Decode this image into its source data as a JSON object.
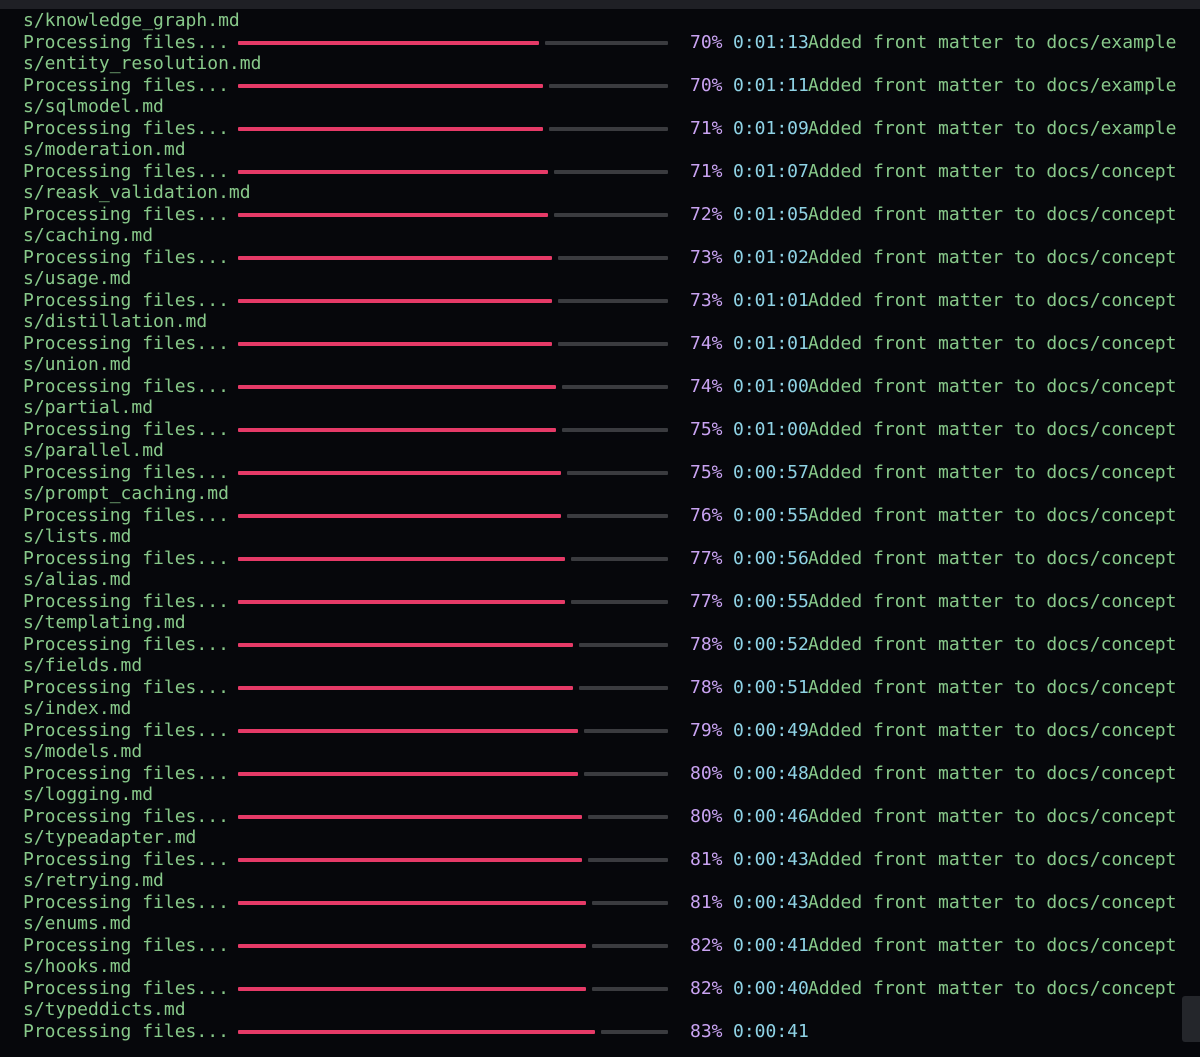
{
  "terminal": {
    "label": "Processing files...",
    "rows": [
      {
        "file": "s/knowledge_graph.md",
        "percent": "70%",
        "progress": 0.7,
        "eta": "0:01:13",
        "message": "Added front matter to docs/example"
      },
      {
        "file": "s/entity_resolution.md",
        "percent": "70%",
        "progress": 0.71,
        "eta": "0:01:11",
        "message": "Added front matter to docs/example"
      },
      {
        "file": "s/sqlmodel.md",
        "percent": "71%",
        "progress": 0.71,
        "eta": "0:01:09",
        "message": "Added front matter to docs/example"
      },
      {
        "file": "s/moderation.md",
        "percent": "71%",
        "progress": 0.72,
        "eta": "0:01:07",
        "message": "Added front matter to docs/concept"
      },
      {
        "file": "s/reask_validation.md",
        "percent": "72%",
        "progress": 0.72,
        "eta": "0:01:05",
        "message": "Added front matter to docs/concept"
      },
      {
        "file": "s/caching.md",
        "percent": "73%",
        "progress": 0.73,
        "eta": "0:01:02",
        "message": "Added front matter to docs/concept"
      },
      {
        "file": "s/usage.md",
        "percent": "73%",
        "progress": 0.73,
        "eta": "0:01:01",
        "message": "Added front matter to docs/concept"
      },
      {
        "file": "s/distillation.md",
        "percent": "74%",
        "progress": 0.73,
        "eta": "0:01:01",
        "message": "Added front matter to docs/concept"
      },
      {
        "file": "s/union.md",
        "percent": "74%",
        "progress": 0.74,
        "eta": "0:01:00",
        "message": "Added front matter to docs/concept"
      },
      {
        "file": "s/partial.md",
        "percent": "75%",
        "progress": 0.74,
        "eta": "0:01:00",
        "message": "Added front matter to docs/concept"
      },
      {
        "file": "s/parallel.md",
        "percent": "75%",
        "progress": 0.75,
        "eta": "0:00:57",
        "message": "Added front matter to docs/concept"
      },
      {
        "file": "s/prompt_caching.md",
        "percent": "76%",
        "progress": 0.75,
        "eta": "0:00:55",
        "message": "Added front matter to docs/concept"
      },
      {
        "file": "s/lists.md",
        "percent": "77%",
        "progress": 0.76,
        "eta": "0:00:56",
        "message": "Added front matter to docs/concept"
      },
      {
        "file": "s/alias.md",
        "percent": "77%",
        "progress": 0.76,
        "eta": "0:00:55",
        "message": "Added front matter to docs/concept"
      },
      {
        "file": "s/templating.md",
        "percent": "78%",
        "progress": 0.78,
        "eta": "0:00:52",
        "message": "Added front matter to docs/concept"
      },
      {
        "file": "s/fields.md",
        "percent": "78%",
        "progress": 0.78,
        "eta": "0:00:51",
        "message": "Added front matter to docs/concept"
      },
      {
        "file": "s/index.md",
        "percent": "79%",
        "progress": 0.79,
        "eta": "0:00:49",
        "message": "Added front matter to docs/concept"
      },
      {
        "file": "s/models.md",
        "percent": "80%",
        "progress": 0.79,
        "eta": "0:00:48",
        "message": "Added front matter to docs/concept"
      },
      {
        "file": "s/logging.md",
        "percent": "80%",
        "progress": 0.8,
        "eta": "0:00:46",
        "message": "Added front matter to docs/concept"
      },
      {
        "file": "s/typeadapter.md",
        "percent": "81%",
        "progress": 0.8,
        "eta": "0:00:43",
        "message": "Added front matter to docs/concept"
      },
      {
        "file": "s/retrying.md",
        "percent": "81%",
        "progress": 0.81,
        "eta": "0:00:43",
        "message": "Added front matter to docs/concept"
      },
      {
        "file": "s/enums.md",
        "percent": "82%",
        "progress": 0.81,
        "eta": "0:00:41",
        "message": "Added front matter to docs/concept"
      },
      {
        "file": "s/hooks.md",
        "percent": "82%",
        "progress": 0.81,
        "eta": "0:00:40",
        "message": "Added front matter to docs/concept"
      },
      {
        "file": "s/typeddicts.md",
        "percent": "83%",
        "progress": 0.83,
        "eta": "0:00:41",
        "message": ""
      }
    ]
  },
  "colors": {
    "background": "#06070b",
    "text_green": "#88c98a",
    "bar_done": "#e53a67",
    "bar_rest": "#3a3b3f",
    "percent": "#c9a3f2",
    "eta": "#8fd3e6"
  }
}
